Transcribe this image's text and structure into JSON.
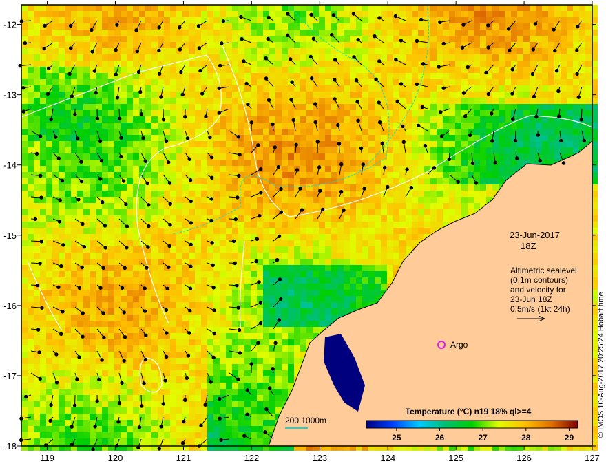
{
  "map": {
    "lon_range": [
      118.62,
      127
    ],
    "lat_range": [
      -18,
      -11.72
    ],
    "lon_ticks": [
      "119",
      "120",
      "121",
      "122",
      "123",
      "124",
      "125",
      "126",
      "127"
    ],
    "lat_ticks": [
      "-12",
      "-13",
      "-14",
      "-15",
      "-16",
      "-17",
      "-18"
    ],
    "land_color": "#ffcc99"
  },
  "annotation": {
    "date": "23-Jun-2017",
    "time": "18Z",
    "lines": [
      "Altimetric sealevel",
      "(0.1m contours)",
      "and velocity for",
      "23-Jun 18Z",
      "0.5m/s (1kt 24h)"
    ],
    "argo_label": "Argo",
    "argo_color": "#e020e0",
    "depth_legend": "200  1000m",
    "depth_color": "#00e0e0"
  },
  "colorbar": {
    "title": "Temperature (°C) n19 18% ql>=4",
    "ticks": [
      "25",
      "26",
      "27",
      "28",
      "29"
    ],
    "range": [
      24.3,
      29.2
    ],
    "stops": [
      "#00007f",
      "#0040ff",
      "#00c8ff",
      "#00c070",
      "#00d000",
      "#e0ff00",
      "#ffc000",
      "#e07000",
      "#800000"
    ]
  },
  "credit": "© IMOS 10-Aug-2017 20:25:24 Hobart time"
}
